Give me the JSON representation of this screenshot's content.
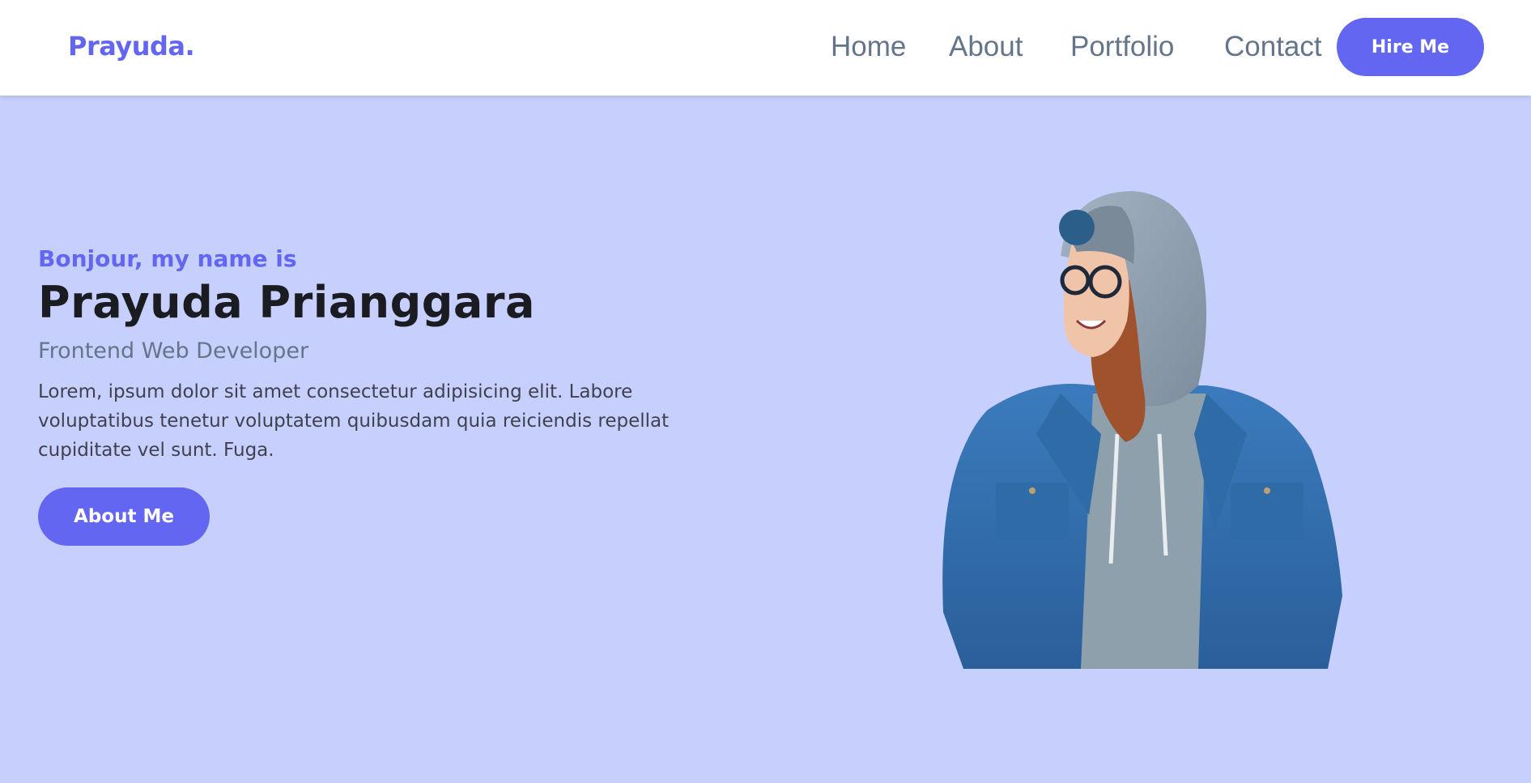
{
  "navbar": {
    "logo": "Prayuda.",
    "links": [
      {
        "label": "Home"
      },
      {
        "label": "About"
      },
      {
        "label": "Portfolio"
      },
      {
        "label": "Contact"
      }
    ],
    "hire_label": "Hire Me"
  },
  "hero": {
    "greeting": "Bonjour, my name is",
    "name": "Prayuda Prianggara",
    "role": "Frontend Web Developer",
    "description": "Lorem, ipsum dolor sit amet consectetur adipisicing elit. Labore voluptatibus tenetur voluptatem quibusdam quia reiciendis repellat cupiditate vel sunt. Fuga.",
    "about_label": "About Me"
  },
  "colors": {
    "accent": "#6366f1",
    "hero_background": "#c7d0fd",
    "nav_text": "#64748b",
    "heading": "#1b1b22"
  }
}
